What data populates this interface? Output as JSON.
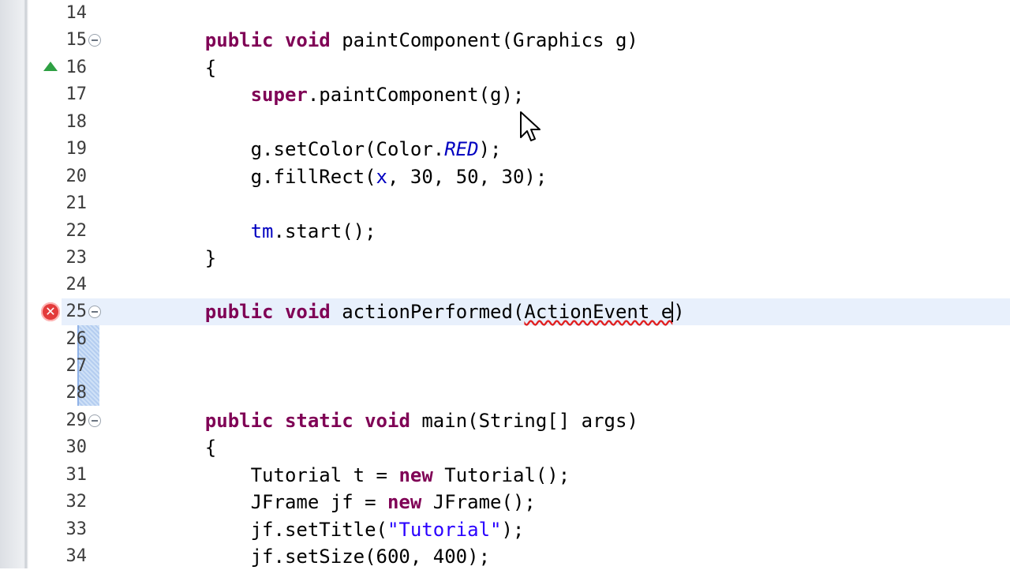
{
  "editor": {
    "lines": [
      {
        "no": "14",
        "tokens": []
      },
      {
        "no": "15",
        "fold": true,
        "marker": "override",
        "tokens": [
          {
            "t": "    "
          },
          {
            "t": "public",
            "c": "kw"
          },
          {
            "t": " "
          },
          {
            "t": "void",
            "c": "kw"
          },
          {
            "t": " paintComponent(Graphics g)"
          }
        ]
      },
      {
        "no": "16",
        "tokens": [
          {
            "t": "    {"
          }
        ]
      },
      {
        "no": "17",
        "tokens": [
          {
            "t": "        "
          },
          {
            "t": "super",
            "c": "kw"
          },
          {
            "t": ".paintComponent(g);"
          }
        ]
      },
      {
        "no": "18",
        "tokens": []
      },
      {
        "no": "19",
        "tokens": [
          {
            "t": "        g.setColor(Color."
          },
          {
            "t": "RED",
            "c": "const"
          },
          {
            "t": ");"
          }
        ]
      },
      {
        "no": "20",
        "tokens": [
          {
            "t": "        g.fillRect("
          },
          {
            "t": "x",
            "c": "fld"
          },
          {
            "t": ", 30, 50, 30);"
          }
        ]
      },
      {
        "no": "21",
        "tokens": []
      },
      {
        "no": "22",
        "tokens": [
          {
            "t": "        "
          },
          {
            "t": "tm",
            "c": "fld"
          },
          {
            "t": ".start();"
          }
        ]
      },
      {
        "no": "23",
        "tokens": [
          {
            "t": "    }"
          }
        ]
      },
      {
        "no": "24",
        "tokens": []
      },
      {
        "no": "25",
        "fold": true,
        "marker": "error",
        "current": true,
        "tokens": [
          {
            "t": "    "
          },
          {
            "t": "public",
            "c": "kw"
          },
          {
            "t": " "
          },
          {
            "t": "void",
            "c": "kw"
          },
          {
            "t": " actionPerformed("
          },
          {
            "t": "ActionEvent e",
            "c": "err"
          },
          {
            "t": "CARET",
            "c": "caret"
          },
          {
            "t": ")"
          }
        ]
      },
      {
        "no": "26",
        "tokens": []
      },
      {
        "no": "27",
        "tokens": []
      },
      {
        "no": "28",
        "tokens": []
      },
      {
        "no": "29",
        "fold": true,
        "tokens": [
          {
            "t": "    "
          },
          {
            "t": "public",
            "c": "kw"
          },
          {
            "t": " "
          },
          {
            "t": "static",
            "c": "kw"
          },
          {
            "t": " "
          },
          {
            "t": "void",
            "c": "kw"
          },
          {
            "t": " main(String[] args)"
          }
        ]
      },
      {
        "no": "30",
        "tokens": [
          {
            "t": "    {"
          }
        ]
      },
      {
        "no": "31",
        "tokens": [
          {
            "t": "        Tutorial t = "
          },
          {
            "t": "new",
            "c": "kw"
          },
          {
            "t": " Tutorial();"
          }
        ]
      },
      {
        "no": "32",
        "tokens": [
          {
            "t": "        JFrame jf = "
          },
          {
            "t": "new",
            "c": "kw"
          },
          {
            "t": " JFrame();"
          }
        ]
      },
      {
        "no": "33",
        "tokens": [
          {
            "t": "        jf.setTitle("
          },
          {
            "t": "\"Tutorial\"",
            "c": "str"
          },
          {
            "t": ");"
          }
        ]
      },
      {
        "no": "34",
        "tokens": [
          {
            "t": "        jf.setSize(600, 400);"
          }
        ]
      }
    ]
  },
  "markers": {
    "override_icon": "override-triangle-icon",
    "error_icon": "error-x-icon",
    "error_glyph": "✕"
  },
  "colors": {
    "keyword": "#7f0055",
    "field": "#0000c0",
    "string": "#2a00ff",
    "current_line": "#e8f0fc",
    "error": "#e02020"
  }
}
